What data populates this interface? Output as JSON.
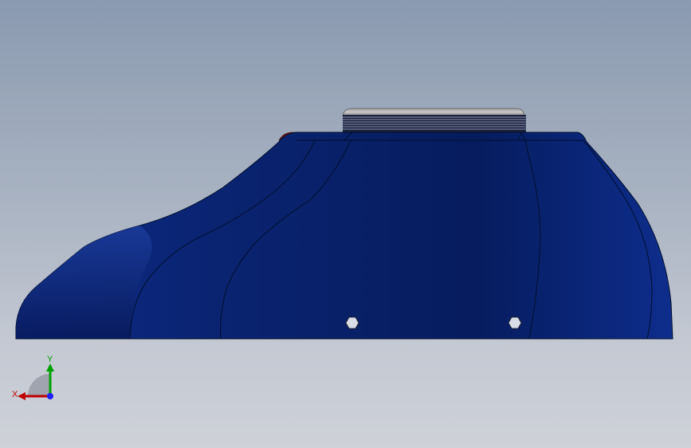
{
  "viewport": {
    "background_top": "#8a9ab0",
    "background_bottom": "#ced1d8"
  },
  "model": {
    "body_color": "#0a2370",
    "body_highlight": "#1a3a9a",
    "cap_color": "#b0b0b0",
    "accent_color": "#8a1a10"
  },
  "triad": {
    "x_label": "X",
    "y_label": "Y",
    "x_color": "#c00000",
    "y_color": "#00a000",
    "z_color": "#2020ff"
  }
}
